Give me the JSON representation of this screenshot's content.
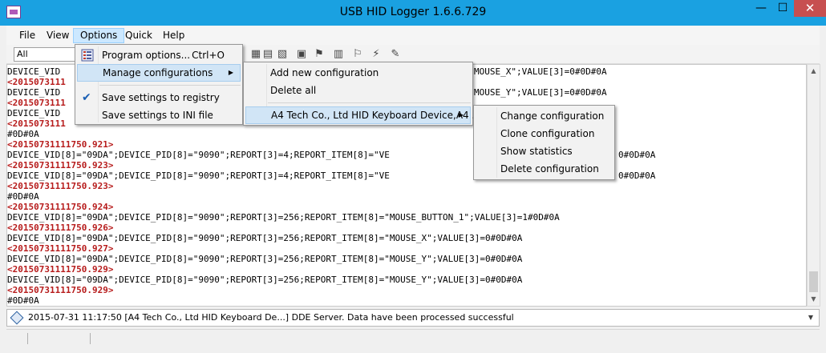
{
  "window": {
    "title": "USB HID Logger 1.6.6.729",
    "minimize": "—",
    "maximize": "☐",
    "close": "✕"
  },
  "menubar": [
    "File",
    "View",
    "Options",
    "Quick",
    "Help"
  ],
  "toolbar": {
    "filter_value": "All",
    "icons": [
      "▦",
      "▤",
      "▧",
      "▣",
      "⚑",
      "▥",
      "⚐",
      "⚡",
      "✎"
    ]
  },
  "log": [
    {
      "type": "data",
      "text": "DEVICE_VID"
    },
    {
      "type": "ts",
      "text": "<2015073111"
    },
    {
      "type": "data",
      "text": "DEVICE_VID"
    },
    {
      "type": "ts",
      "text": "<2015073111"
    },
    {
      "type": "data",
      "text": "DEVICE_VID"
    },
    {
      "type": "ts",
      "text": "<2015073111"
    },
    {
      "type": "data",
      "text": "#0D#0A"
    },
    {
      "type": "ts",
      "text": "<20150731111750.921>"
    },
    {
      "type": "data",
      "text": "DEVICE_VID[8]=\"09DA\";DEVICE_PID[8]=\"9090\";REPORT[3]=4;REPORT_ITEM[8]=\"VE"
    },
    {
      "type": "ts",
      "text": "<20150731111750.923>"
    },
    {
      "type": "data",
      "text": "DEVICE_VID[8]=\"09DA\";DEVICE_PID[8]=\"9090\";REPORT[3]=4;REPORT_ITEM[8]=\"VE"
    },
    {
      "type": "ts",
      "text": "<20150731111750.923>"
    },
    {
      "type": "data",
      "text": "#0D#0A"
    },
    {
      "type": "ts",
      "text": "<20150731111750.924>"
    },
    {
      "type": "data",
      "text": "DEVICE_VID[8]=\"09DA\";DEVICE_PID[8]=\"9090\";REPORT[3]=256;REPORT_ITEM[8]=\"MOUSE_BUTTON_1\";VALUE[3]=1#0D#0A"
    },
    {
      "type": "ts",
      "text": "<20150731111750.926>"
    },
    {
      "type": "data",
      "text": "DEVICE_VID[8]=\"09DA\";DEVICE_PID[8]=\"9090\";REPORT[3]=256;REPORT_ITEM[8]=\"MOUSE_X\";VALUE[3]=0#0D#0A"
    },
    {
      "type": "ts",
      "text": "<20150731111750.927>"
    },
    {
      "type": "data",
      "text": "DEVICE_VID[8]=\"09DA\";DEVICE_PID[8]=\"9090\";REPORT[3]=256;REPORT_ITEM[8]=\"MOUSE_Y\";VALUE[3]=0#0D#0A"
    },
    {
      "type": "ts",
      "text": "<20150731111750.929>"
    },
    {
      "type": "data",
      "text": "DEVICE_VID[8]=\"09DA\";DEVICE_PID[8]=\"9090\";REPORT[3]=256;REPORT_ITEM[8]=\"MOUSE_Y\";VALUE[3]=0#0D#0A"
    },
    {
      "type": "ts",
      "text": "<20150731111750.929>"
    },
    {
      "type": "data",
      "text": "#0D#0A"
    }
  ],
  "log_fragments": [
    "MOUSE_X\";VALUE[3]=0#0D#0A",
    "MOUSE_Y\";VALUE[3]=0#0D#0A",
    "0#0D#0A",
    "0#0D#0A"
  ],
  "status": {
    "text": "2015-07-31 11:17:50 [A4 Tech Co., Ltd HID Keyboard De...] DDE Server. Data have been processed successful",
    "dropdown": "▼"
  },
  "options_menu": [
    {
      "label": "Program options...",
      "shortcut": "Ctrl+O",
      "icon": "options-list-icon"
    },
    {
      "label": "Manage configurations",
      "submenu": true
    },
    {
      "label": "Save settings to registry",
      "checked": true
    },
    {
      "label": "Save settings to INI file"
    }
  ],
  "config_menu": [
    {
      "label": "Add new configuration"
    },
    {
      "label": "Delete all"
    },
    {
      "label": "A4 Tech Co., Ltd HID Keyboard Device,A4 ...",
      "submenu": true
    }
  ],
  "device_menu": [
    {
      "label": "Change configuration"
    },
    {
      "label": "Clone configuration"
    },
    {
      "label": "Show statistics"
    },
    {
      "label": "Delete configuration"
    }
  ],
  "glyphs": {
    "check": "✔",
    "submenu_arrow": "▶",
    "scroll_up": "▲",
    "scroll_down": "▼"
  },
  "colors": {
    "titlebar": "#1aa1e1",
    "timestamp": "#b71c1c",
    "menu_highlight": "#d1e5f6",
    "close_button": "#c74f50"
  }
}
